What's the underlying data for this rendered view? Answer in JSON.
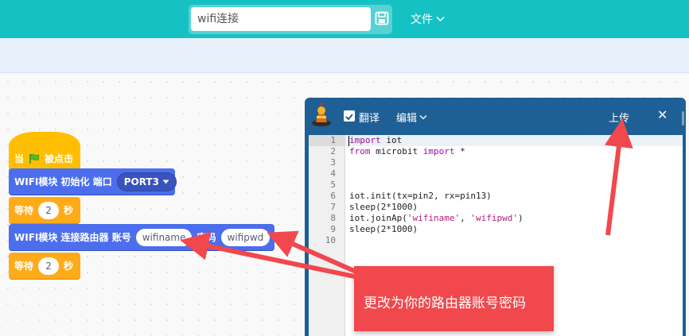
{
  "header": {
    "project_name": "wifi连接",
    "save_icon": "save-icon",
    "file_menu_label": "文件"
  },
  "blocks": {
    "when_flag": {
      "prefix": "当",
      "flag_icon": "green-flag-icon",
      "suffix": "被点击"
    },
    "wifi_init": {
      "label": "WIFI模块 初始化 端口",
      "port_value": "PORT3"
    },
    "wait1": {
      "prefix": "等待",
      "value": "2",
      "unit": "秒"
    },
    "wifi_connect": {
      "label": "WIFI模块 连接路由器 账号",
      "ssid_value": "wifiname",
      "pwd_label": "密码",
      "pwd_value": "wifipwd"
    },
    "wait2": {
      "prefix": "等待",
      "value": "2",
      "unit": "秒"
    }
  },
  "code_panel": {
    "translate_label": "翻译",
    "translate_checked": true,
    "edit_menu_label": "编辑",
    "upload_label": "上传",
    "close_label": "✕",
    "line_numbers": [
      "1",
      "2",
      "3",
      "4",
      "5",
      "6",
      "7",
      "8",
      "9",
      "10"
    ],
    "lines": [
      "import iot",
      "from microbit import *",
      "",
      "",
      "",
      "iot.init(tx=pin2, rx=pin13)",
      "sleep(2*1000)",
      "iot.joinAp('wifiname', 'wifipwd')",
      "sleep(2*1000)",
      ""
    ]
  },
  "annotation": {
    "text": "更改为你的路由器账号密码",
    "color": "#f0484d"
  },
  "colors": {
    "topbar": "#16c1c4",
    "event_block": "#ffbf00",
    "wifi_block": "#4c6eed",
    "control_block": "#ffab19",
    "panel": "#1e5f95"
  }
}
